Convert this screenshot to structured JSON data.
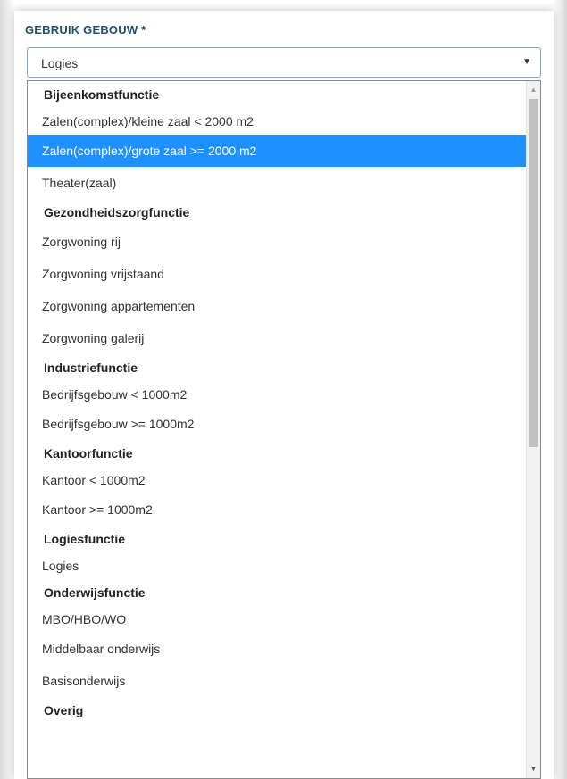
{
  "field": {
    "label": "GEBRUIK GEBOUW *",
    "selected_value": "Logies",
    "caret": "▼"
  },
  "dropdown": {
    "items": [
      {
        "kind": "group",
        "label": "Bijeenkomstfunctie"
      },
      {
        "kind": "option",
        "label": "Zalen(complex)/kleine zaal < 2000 m2"
      },
      {
        "kind": "option",
        "label": "Zalen(complex)/grote zaal >= 2000 m2",
        "highlighted": true
      },
      {
        "kind": "option",
        "label": "Theater(zaal)"
      },
      {
        "kind": "group",
        "label": "Gezondheidszorgfunctie"
      },
      {
        "kind": "option",
        "label": "Zorgwoning rij"
      },
      {
        "kind": "option",
        "label": "Zorgwoning vrijstaand"
      },
      {
        "kind": "option",
        "label": "Zorgwoning appartementen"
      },
      {
        "kind": "option",
        "label": "Zorgwoning galerij"
      },
      {
        "kind": "group",
        "label": "Industriefunctie"
      },
      {
        "kind": "option",
        "label": "Bedrijfsgebouw < 1000m2"
      },
      {
        "kind": "option",
        "label": "Bedrijfsgebouw >= 1000m2"
      },
      {
        "kind": "group",
        "label": "Kantoorfunctie"
      },
      {
        "kind": "option",
        "label": "Kantoor < 1000m2"
      },
      {
        "kind": "option",
        "label": "Kantoor >= 1000m2"
      },
      {
        "kind": "group",
        "label": "Logiesfunctie"
      },
      {
        "kind": "option",
        "label": "Logies"
      },
      {
        "kind": "group",
        "label": "Onderwijsfunctie"
      },
      {
        "kind": "option",
        "label": "MBO/HBO/WO"
      },
      {
        "kind": "option",
        "label": "Middelbaar onderwijs"
      },
      {
        "kind": "option",
        "label": "Basisonderwijs"
      },
      {
        "kind": "group",
        "label": "Overig"
      }
    ]
  },
  "scrollbar": {
    "up_arrow": "▲",
    "down_arrow": "▼"
  },
  "colors": {
    "label": "#1f4e6e",
    "highlight": "#1e90ff",
    "select_border": "#7aa7d6"
  }
}
